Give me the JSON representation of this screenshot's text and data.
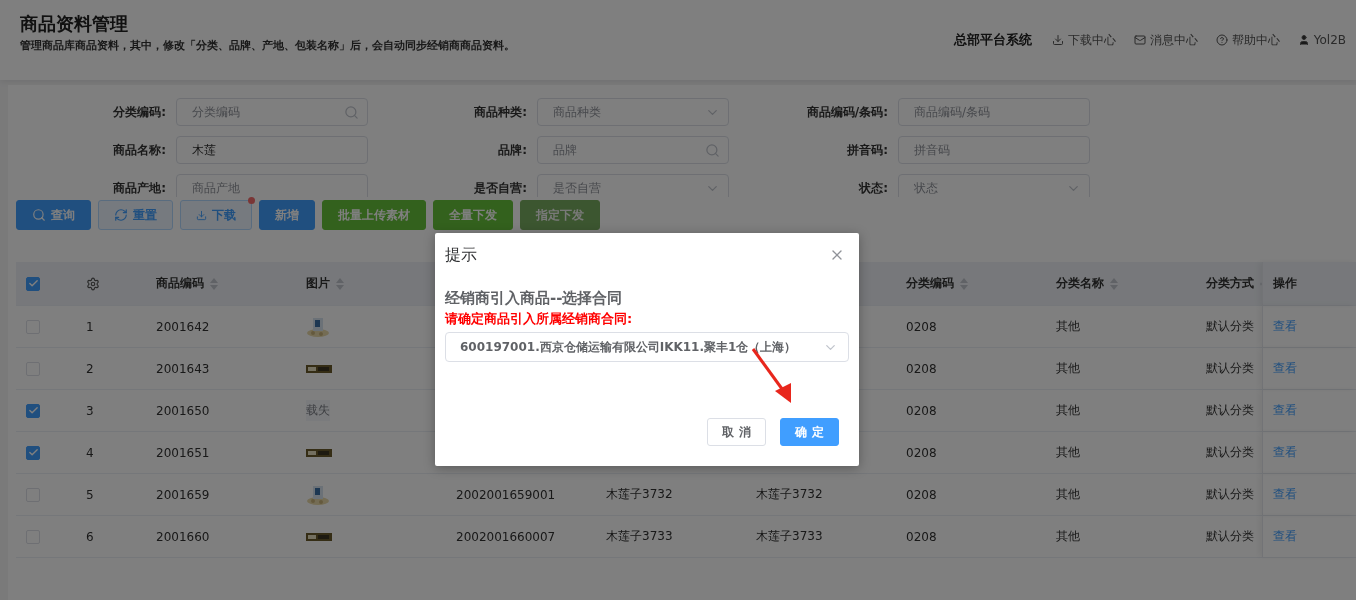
{
  "page": {
    "title": "商品资料管理",
    "subtitle": "管理商品库商品资料，其中，修改「分类、品牌、产地、包装名称」后，会自动同步经销商商品资料。"
  },
  "topbar": {
    "system": "总部平台系统",
    "links": [
      "下载中心",
      "消息中心",
      "帮助中心"
    ],
    "user": "Yol2B"
  },
  "filters": [
    {
      "label": "分类编码:",
      "kind": "search",
      "placeholder": "分类编码"
    },
    {
      "label": "商品种类:",
      "kind": "select",
      "placeholder": "商品种类"
    },
    {
      "label": "商品编码/条码:",
      "kind": "text",
      "placeholder": "商品编码/条码"
    },
    {
      "label": "商品名称:",
      "kind": "text",
      "value": "木莲"
    },
    {
      "label": "品牌:",
      "kind": "search",
      "placeholder": "品牌"
    },
    {
      "label": "拼音码:",
      "kind": "text",
      "placeholder": "拼音码"
    },
    {
      "label": "商品产地:",
      "kind": "text",
      "placeholder": "商品产地"
    },
    {
      "label": "是否自营:",
      "kind": "select",
      "placeholder": "是否自营"
    },
    {
      "label": "状态:",
      "kind": "select",
      "placeholder": "状态"
    }
  ],
  "buttons": [
    {
      "label": "查询",
      "kind": "primary",
      "badge": false,
      "disabled": false
    },
    {
      "label": "重置",
      "kind": "plain",
      "badge": false,
      "disabled": false
    },
    {
      "label": "下载",
      "kind": "plain",
      "badge": true,
      "disabled": false
    },
    {
      "label": "新增",
      "kind": "primary",
      "badge": false,
      "disabled": false
    },
    {
      "label": "批量上传素材",
      "kind": "success",
      "badge": false,
      "disabled": false
    },
    {
      "label": "全量下发",
      "kind": "success",
      "badge": false,
      "disabled": false
    },
    {
      "label": "指定下发",
      "kind": "success",
      "badge": false,
      "disabled": true
    }
  ],
  "table": {
    "select_all": {
      "checked": true
    },
    "columns": [
      {
        "label": "商品编码",
        "sortable": true
      },
      {
        "label": "图片",
        "sortable": true
      },
      null,
      null,
      null,
      {
        "label": "分类编码",
        "sortable": true
      },
      {
        "label": "分类名称",
        "sortable": true
      },
      {
        "label": "分类方式",
        "sortable": true
      },
      {
        "label": "操作",
        "sortable": false
      }
    ],
    "rows": [
      {
        "checked": false,
        "index": "1",
        "code": "2001642",
        "picture": {
          "kind": "jar"
        },
        "cat_code": "0208",
        "cat_name": "其他",
        "cat_way": "默认分类",
        "action": "查看"
      },
      {
        "checked": false,
        "index": "2",
        "code": "2001643",
        "picture": {
          "kind": "strip"
        },
        "cat_code": "0208",
        "cat_name": "其他",
        "cat_way": "默认分类",
        "action": "查看"
      },
      {
        "checked": true,
        "index": "3",
        "code": "2001650",
        "picture": {
          "kind": "failed",
          "text": "载失"
        },
        "cat_code": "0208",
        "cat_name": "其他",
        "cat_way": "默认分类",
        "action": "查看"
      },
      {
        "checked": true,
        "index": "4",
        "code": "2001651",
        "picture": {
          "kind": "strip"
        },
        "cat_code": "0208",
        "cat_name": "其他",
        "cat_way": "默认分类",
        "action": "查看"
      },
      {
        "checked": false,
        "index": "5",
        "code": "2001659",
        "picture": {
          "kind": "jar"
        },
        "barcode": "2002001659001",
        "name": "木莲子3732",
        "name2": "木莲子3732",
        "cat_code": "0208",
        "cat_name": "其他",
        "cat_way": "默认分类",
        "action": "查看"
      },
      {
        "checked": false,
        "index": "6",
        "code": "2001660",
        "picture": {
          "kind": "strip"
        },
        "barcode": "2002001660007",
        "name": "木莲子3733",
        "name2": "木莲子3733",
        "cat_code": "0208",
        "cat_name": "其他",
        "cat_way": "默认分类",
        "action": "查看"
      }
    ]
  },
  "dialog": {
    "title": "提示",
    "heading": "经销商引入商品--选择合同",
    "instruction": "请确定商品引入所属经销商合同:",
    "contract": "600197001.西京仓储运输有限公司IKK11.聚丰1仓（上海）",
    "buttons": [
      {
        "label": "取 消",
        "kind": "plain"
      },
      {
        "label": "确 定",
        "kind": "primary"
      }
    ],
    "arrow": true
  }
}
